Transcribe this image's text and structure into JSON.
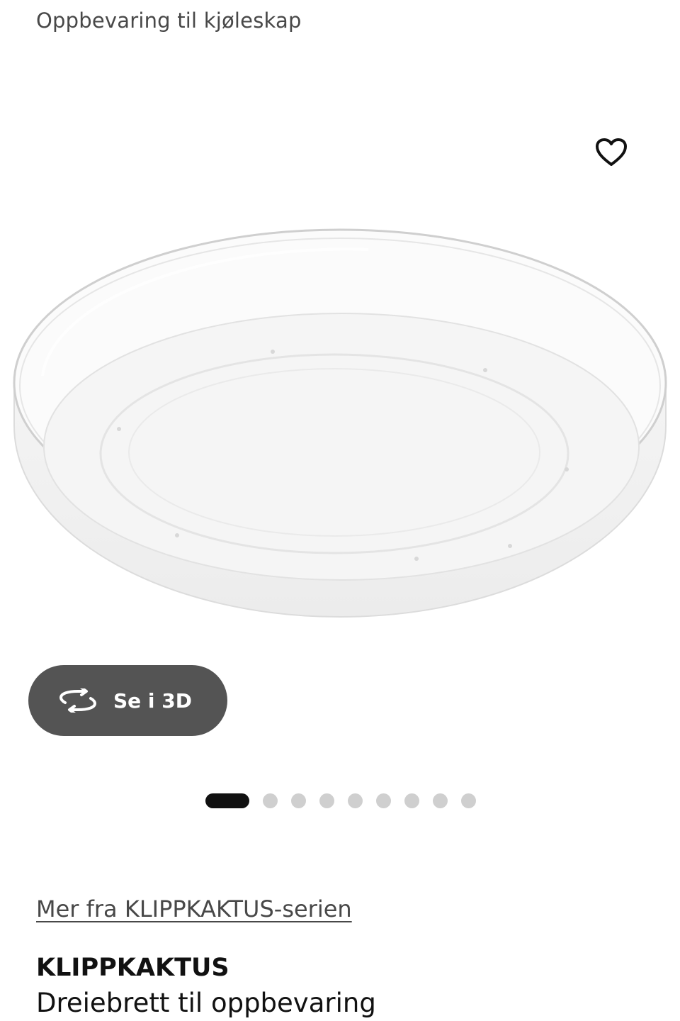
{
  "breadcrumb": "Oppbevaring til kjøleskap",
  "favorite": {
    "icon": "heart-outline-icon"
  },
  "image": {
    "alt": "KLIPPKAKTUS Dreiebrett til oppbevaring"
  },
  "view_3d": {
    "label": "Se i 3D",
    "icon": "rotate-3d-icon"
  },
  "carousel": {
    "total": 9,
    "active": 1
  },
  "series_link": "Mer fra KLIPPKAKTUS-serien",
  "product": {
    "name": "KLIPPKAKTUS",
    "description": "Dreiebrett til oppbevaring"
  },
  "colors": {
    "button_bg": "#545454",
    "active_dot": "#111111",
    "inactive_dot": "#cfcfcf",
    "text_secondary": "#484848"
  }
}
